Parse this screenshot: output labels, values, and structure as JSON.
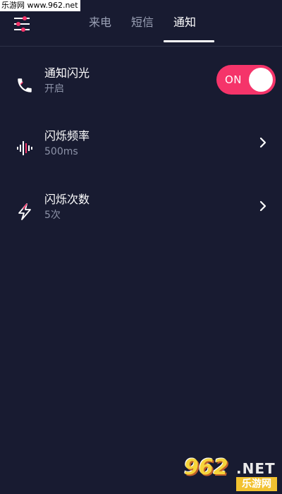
{
  "watermark": {
    "top_text": "乐游网 www.962.net",
    "logo_number": "962",
    "logo_net": ".NET",
    "logo_site": "乐游网"
  },
  "header": {
    "menu_icon": "settings-sliders-icon",
    "tabs": [
      {
        "label": "来电",
        "active": false
      },
      {
        "label": "短信",
        "active": false
      },
      {
        "label": "通知",
        "active": true
      }
    ]
  },
  "settings": [
    {
      "icon": "phone-icon",
      "title": "通知闪光",
      "subtitle": "开启",
      "control": "toggle",
      "toggle_label": "ON",
      "toggle_on": true
    },
    {
      "icon": "waveform-icon",
      "title": "闪烁频率",
      "subtitle": "500ms",
      "control": "chevron"
    },
    {
      "icon": "lightning-icon",
      "title": "闪烁次数",
      "subtitle": "5次",
      "control": "chevron"
    }
  ],
  "colors": {
    "background": "#181b31",
    "accent": "#f5346a",
    "text_primary": "#ffffff",
    "text_secondary": "#8d93a8"
  }
}
